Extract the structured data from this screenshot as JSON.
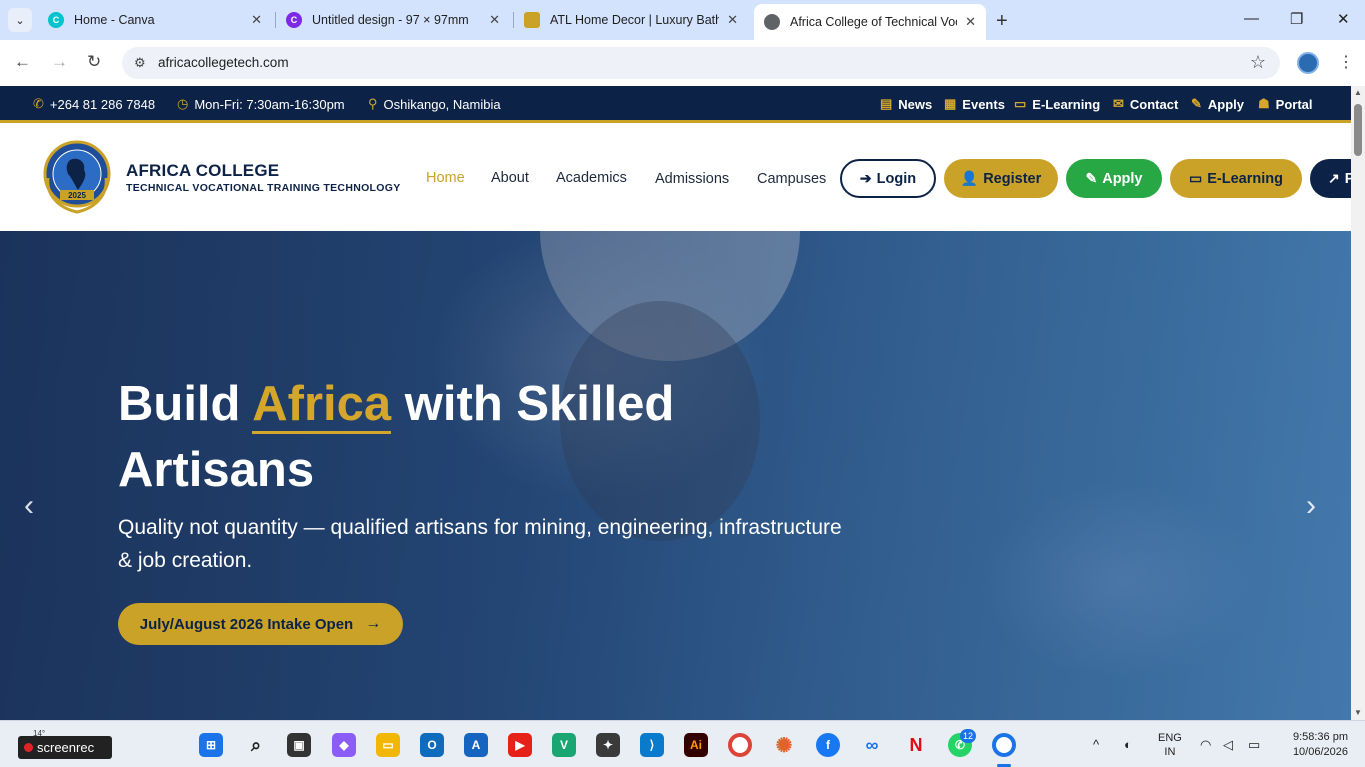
{
  "browser": {
    "tabs": [
      {
        "title": "Home - Canva",
        "active": false
      },
      {
        "title": "Untitled design - 97 × 97mm",
        "active": false
      },
      {
        "title": "ATL Home Decor | Luxury Bathr",
        "active": false
      },
      {
        "title": "Africa College of Technical Voca",
        "active": true
      }
    ],
    "url": "africacollegetech.com"
  },
  "topbar": {
    "phone": "+264 81 286 7848",
    "hours": "Mon-Fri: 7:30am-16:30pm",
    "location": "Oshikango, Namibia",
    "links": [
      "News",
      "Events",
      "E-Learning",
      "Contact",
      "Apply",
      "Portal"
    ]
  },
  "brand": {
    "name": "AFRICA COLLEGE",
    "subtitle": "TECHNICAL VOCATIONAL TRAINING TECHNOLOGY",
    "logo_year": "2025"
  },
  "nav": {
    "links": [
      "Home",
      "About",
      "Academics",
      "Admissions",
      "Campuses"
    ],
    "active": "Home",
    "buttons": {
      "login": "Login",
      "register": "Register",
      "apply": "Apply",
      "elearning": "E-Learning",
      "portal": "P"
    }
  },
  "hero": {
    "title_pre": "Build ",
    "title_highlight": "Africa",
    "title_post": " with Skilled Artisans",
    "subtitle": "Quality not quantity — qualified artisans for mining, engineering, infrastructure & job creation.",
    "cta": "July/August 2026 Intake Open"
  },
  "taskbar": {
    "weather": "14°",
    "screenrec": "screenrec",
    "whatsapp_badge": "12",
    "lang_top": "ENG",
    "lang_bottom": "IN",
    "time": "9:58:36 pm",
    "date": "10/06/2026"
  },
  "colors": {
    "navy": "#0c2246",
    "gold": "#c9a227",
    "green": "#28a745"
  }
}
